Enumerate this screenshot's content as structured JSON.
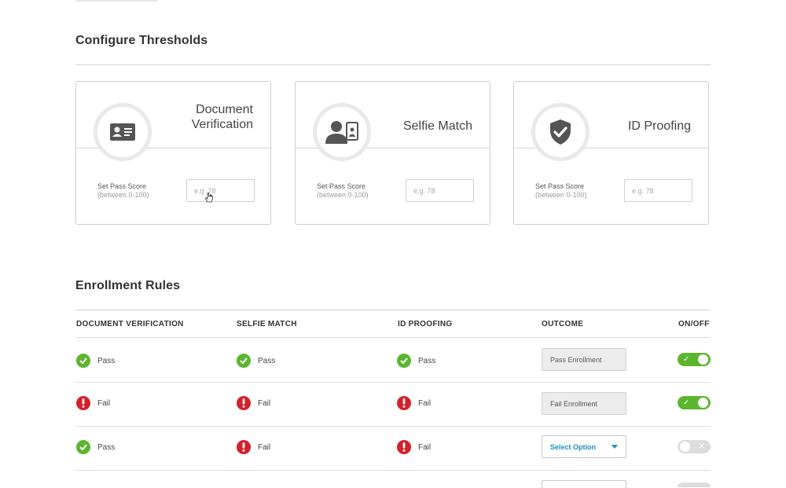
{
  "thresholds": {
    "title": "Configure Thresholds",
    "cards": [
      {
        "title_line1": "Document",
        "title_line2": "Verification",
        "icon": "id-card-icon",
        "label": "Set Pass Score",
        "sublabel": "(between 0-100)",
        "placeholder": "e.g. 78"
      },
      {
        "title_line1": "Selfie Match",
        "title_line2": "",
        "icon": "selfie-icon",
        "label": "Set Pass Score",
        "sublabel": "(between 0-100)",
        "placeholder": "e.g. 78"
      },
      {
        "title_line1": "ID Proofing",
        "title_line2": "",
        "icon": "shield-check-icon",
        "label": "Set Pass Score",
        "sublabel": "(between 0-100)",
        "placeholder": "e.g. 78"
      }
    ]
  },
  "enrollment": {
    "title": "Enrollment Rules",
    "columns": {
      "doc": "DOCUMENT VERIFICATION",
      "selfie": "SELFIE MATCH",
      "id": "ID PROOFING",
      "outcome": "OUTCOME",
      "onoff": "ON/OFF"
    },
    "rows": [
      {
        "doc": "Pass",
        "selfie": "Pass",
        "id": "Pass",
        "outcome": "Pass Enrollment",
        "outcome_type": "readonly",
        "enabled": true
      },
      {
        "doc": "Fail",
        "selfie": "Fail",
        "id": "Fail",
        "outcome": "Fail Enrollment",
        "outcome_type": "readonly",
        "enabled": true
      },
      {
        "doc": "Pass",
        "selfie": "Fail",
        "id": "Fail",
        "outcome": "Select Option",
        "outcome_type": "select",
        "enabled": false
      }
    ]
  },
  "colors": {
    "pass": "#5cb52e",
    "fail": "#d4202a",
    "link": "#1c8fc0",
    "icon": "#555555"
  }
}
